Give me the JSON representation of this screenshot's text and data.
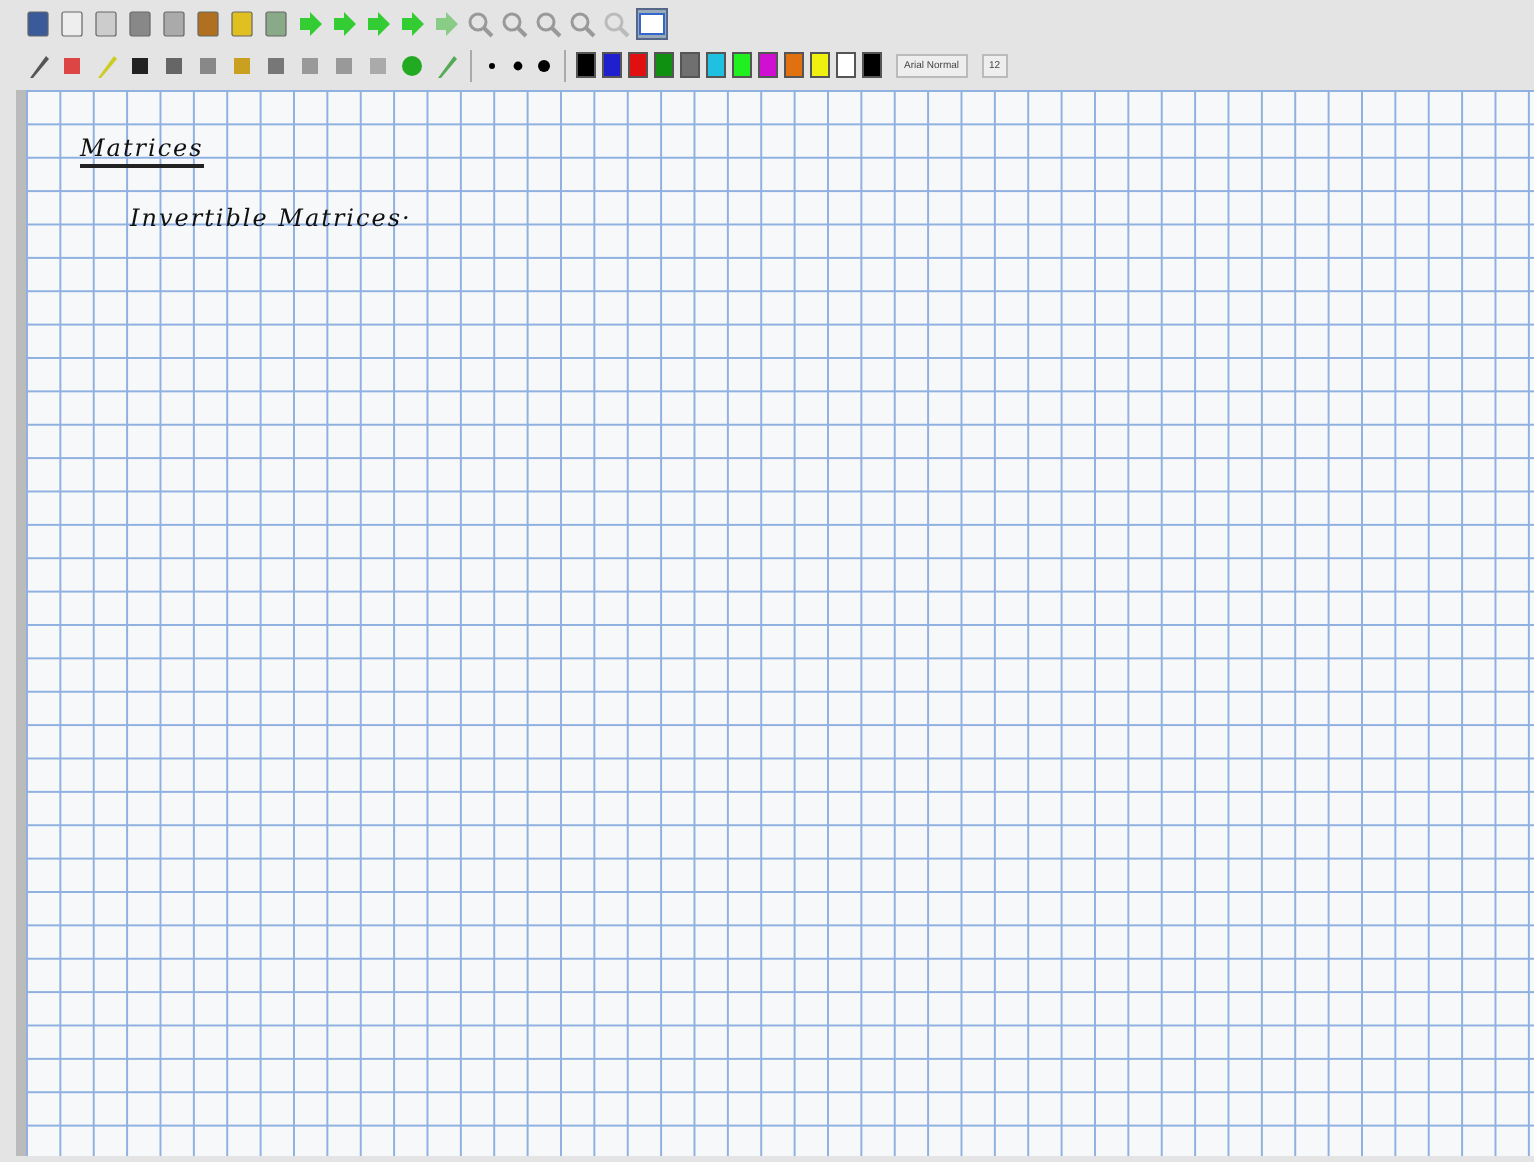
{
  "notes": [
    {
      "text": "Matrices",
      "kind": "heading"
    },
    {
      "text": "Invertible Matrices·",
      "kind": "item"
    }
  ],
  "swatches": [
    {
      "color": "#000000"
    },
    {
      "color": "#1f1fd0"
    },
    {
      "color": "#e01010"
    },
    {
      "color": "#109010"
    },
    {
      "color": "#707070"
    },
    {
      "color": "#20c0e0"
    },
    {
      "color": "#20f020"
    },
    {
      "color": "#d010d0"
    },
    {
      "color": "#e07010"
    },
    {
      "color": "#f0f010"
    },
    {
      "color": "#ffffff"
    },
    {
      "color": "#000000"
    }
  ],
  "font": {
    "name": "Arial Normal",
    "size": "12"
  }
}
